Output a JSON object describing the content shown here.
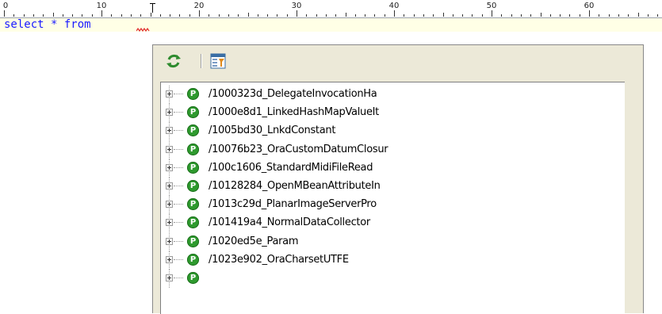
{
  "ruler": {
    "labels": [
      "0",
      "10",
      "20",
      "30",
      "40",
      "50",
      "60"
    ]
  },
  "editor": {
    "line_1": "select * from",
    "text_color": "#1a1aff",
    "current_line_color": "#ffffe6"
  },
  "popup": {
    "toolbar": {
      "refresh_icon": "refresh-icon",
      "filter_icon": "object-filter-icon"
    },
    "items": [
      {
        "icon": "P",
        "label": "/1000323d_DelegateInvocationHa"
      },
      {
        "icon": "P",
        "label": "/1000e8d1_LinkedHashMapValueIt"
      },
      {
        "icon": "P",
        "label": "/1005bd30_LnkdConstant"
      },
      {
        "icon": "P",
        "label": "/10076b23_OraCustomDatumClosur"
      },
      {
        "icon": "P",
        "label": "/100c1606_StandardMidiFileRead"
      },
      {
        "icon": "P",
        "label": "/10128284_OpenMBeanAttributeIn"
      },
      {
        "icon": "P",
        "label": "/1013c29d_PlanarImageServerPro"
      },
      {
        "icon": "P",
        "label": "/101419a4_NormalDataCollector"
      },
      {
        "icon": "P",
        "label": "/1020ed5e_Param"
      },
      {
        "icon": "P",
        "label": "/1023e902_OraCharsetUTFE"
      },
      {
        "icon": "P",
        "label": ""
      }
    ],
    "scrollbar": {
      "position": 0
    }
  }
}
